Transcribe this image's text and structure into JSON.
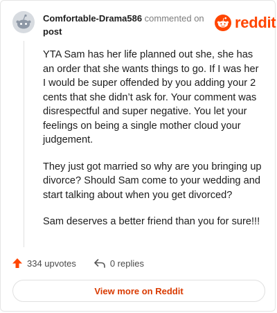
{
  "comment": {
    "username": "Comfortable-Drama586",
    "action_text": "commented on",
    "target_text": "post",
    "paragraphs": [
      "YTA Sam has her life planned out she, she has an order that she wants things to go. If I was her I would be super offended by you adding your 2 cents that she didn’t ask for. Your comment was disrespectful and super negative. You let your feelings on being a single mother cloud your judgement.",
      "They just got married so why are you bringing up divorce? Should Sam come to your wedding and start talking about when you get divorced?",
      "Sam deserves a better friend than you for sure!!!"
    ]
  },
  "brand": {
    "wordmark": "reddit",
    "color": "#ff4500"
  },
  "actions": {
    "upvotes_label": "334 upvotes",
    "replies_label": "0 replies"
  },
  "footer": {
    "view_more_label": "View more on Reddit"
  },
  "colors": {
    "accent": "#ff4500",
    "link": "#d93a00",
    "avatar": "#d7dbe0"
  }
}
